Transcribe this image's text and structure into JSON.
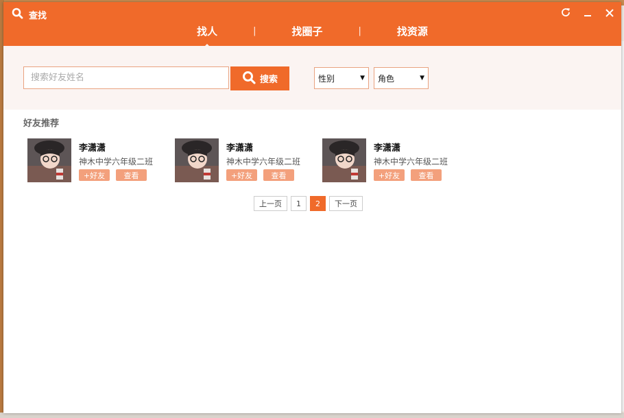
{
  "window": {
    "title": "查找",
    "controls": [
      "refresh-icon",
      "minimize-icon",
      "close-icon"
    ]
  },
  "tabs": [
    {
      "label": "找人",
      "active": true
    },
    {
      "label": "找圈子",
      "active": false
    },
    {
      "label": "找资源",
      "active": false
    }
  ],
  "tab_separator": "|",
  "search": {
    "placeholder": "搜索好友姓名",
    "value": "",
    "button_label": "搜索"
  },
  "filters": {
    "gender": "性别",
    "role": "角色"
  },
  "section_title": "好友推荐",
  "friends": [
    {
      "name": "李潇潇",
      "school": "神木中学六年级二班",
      "add_label": "+好友",
      "view_label": "查看"
    },
    {
      "name": "李潇潇",
      "school": "神木中学六年级二班",
      "add_label": "+好友",
      "view_label": "查看"
    },
    {
      "name": "李潇潇",
      "school": "神木中学六年级二班",
      "add_label": "+好友",
      "view_label": "查看"
    }
  ],
  "pagination": {
    "prev_label": "上一页",
    "pages": [
      "1",
      "2"
    ],
    "current": "2",
    "next_label": "下一页"
  },
  "colors": {
    "accent": "#f06a2a",
    "panel": "#fbf4f2",
    "action_button": "#f3a07c"
  }
}
